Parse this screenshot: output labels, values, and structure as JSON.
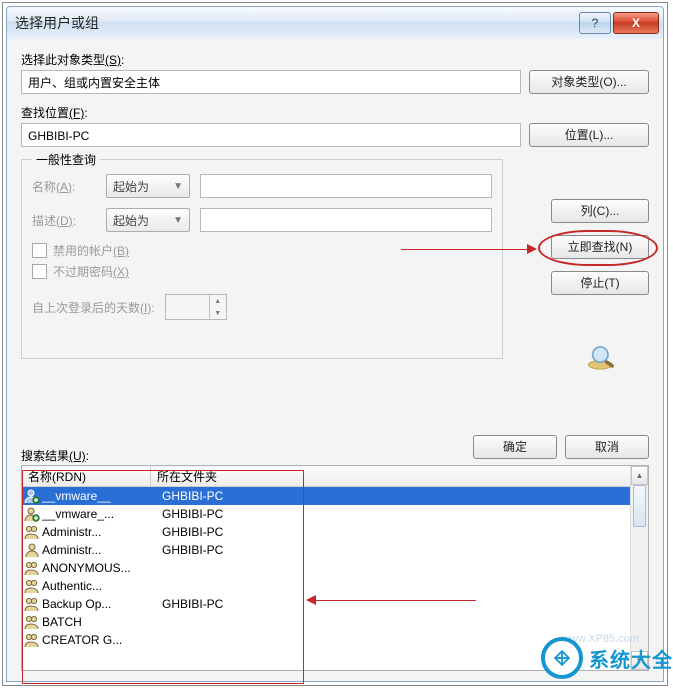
{
  "titlebar": {
    "title": "选择用户或组"
  },
  "section1": {
    "label_pre": "选择此对象类型",
    "label_u": "(S)",
    "label_post": ":",
    "value": "用户、组或内置安全主体",
    "button": "对象类型(O)..."
  },
  "section2": {
    "label_pre": "查找位置",
    "label_u": "(F)",
    "label_post": ":",
    "value": "GHBIBI-PC",
    "button": "位置(L)..."
  },
  "fieldset": {
    "legend": "一般性查询",
    "name_label_pre": "名称",
    "name_label_u": "(A)",
    "name_label_post": ":",
    "desc_label_pre": "描述",
    "desc_label_u": "(D)",
    "desc_label_post": ":",
    "combo_text": "起始为",
    "chk1_pre": "禁用的帐户",
    "chk1_u": "(B)",
    "chk2_pre": "不过期密码",
    "chk2_u": "(X)",
    "days_label_pre": "自上次登录后的天数",
    "days_label_u": "(I)",
    "days_label_post": ":"
  },
  "sidebuttons": {
    "columns": "列(C)...",
    "search": "立即查找(N)",
    "stop": "停止(T)"
  },
  "okcancel": {
    "ok": "确定",
    "cancel": "取消"
  },
  "results": {
    "label_pre": "搜索结果",
    "label_u": "(U)",
    "label_post": ":",
    "col1": "名称(RDN)",
    "col2": "所在文件夹",
    "rows": [
      {
        "name": "__vmware__",
        "folder": "GHBIBI-PC",
        "icon": "user-badge",
        "selected": true
      },
      {
        "name": "__vmware_...",
        "folder": "GHBIBI-PC",
        "icon": "user-badge"
      },
      {
        "name": "Administr...",
        "folder": "GHBIBI-PC",
        "icon": "users"
      },
      {
        "name": "Administr...",
        "folder": "GHBIBI-PC",
        "icon": "user"
      },
      {
        "name": "ANONYMOUS...",
        "folder": "",
        "icon": "users"
      },
      {
        "name": "Authentic...",
        "folder": "",
        "icon": "users"
      },
      {
        "name": "Backup Op...",
        "folder": "GHBIBI-PC",
        "icon": "users"
      },
      {
        "name": "BATCH",
        "folder": "",
        "icon": "users"
      },
      {
        "name": "CREATOR G...",
        "folder": "",
        "icon": "users"
      }
    ]
  },
  "watermark": "www.XP85.com",
  "brand": "系统大全"
}
